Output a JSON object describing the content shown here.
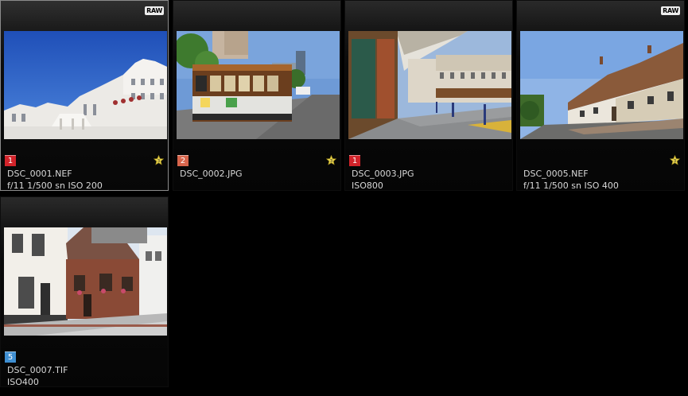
{
  "thumbnails": [
    {
      "file_name": "DSC_0001.NEF",
      "info": "f/11 1/500 sn ISO 200",
      "label_number": "1",
      "label_color": "#d2232a",
      "raw_badge": "RAW",
      "rating_stars": "3",
      "selected": true,
      "image": "white-building-blue-sky"
    },
    {
      "file_name": "DSC_0002.JPG",
      "info": "",
      "label_number": "2",
      "label_color": "#d7654c",
      "raw_badge": "",
      "rating_stars": "3",
      "selected": false,
      "image": "cable-car-street"
    },
    {
      "file_name": "DSC_0003.JPG",
      "info": "ISO800",
      "label_number": "1",
      "label_color": "#d2232a",
      "raw_badge": "",
      "rating_stars": "",
      "selected": false,
      "image": "shop-street-awning"
    },
    {
      "file_name": "DSC_0005.NEF",
      "info": "f/11 1/500 sn ISO 400",
      "label_number": "",
      "label_color": "",
      "raw_badge": "RAW",
      "rating_stars": "3",
      "selected": false,
      "image": "village-street-houses"
    },
    {
      "file_name": "DSC_0007.TIF",
      "info": "ISO400",
      "label_number": "5",
      "label_color": "#3f8fd2",
      "raw_badge": "",
      "rating_stars": "",
      "selected": false,
      "image": "brick-cottage-street"
    }
  ]
}
